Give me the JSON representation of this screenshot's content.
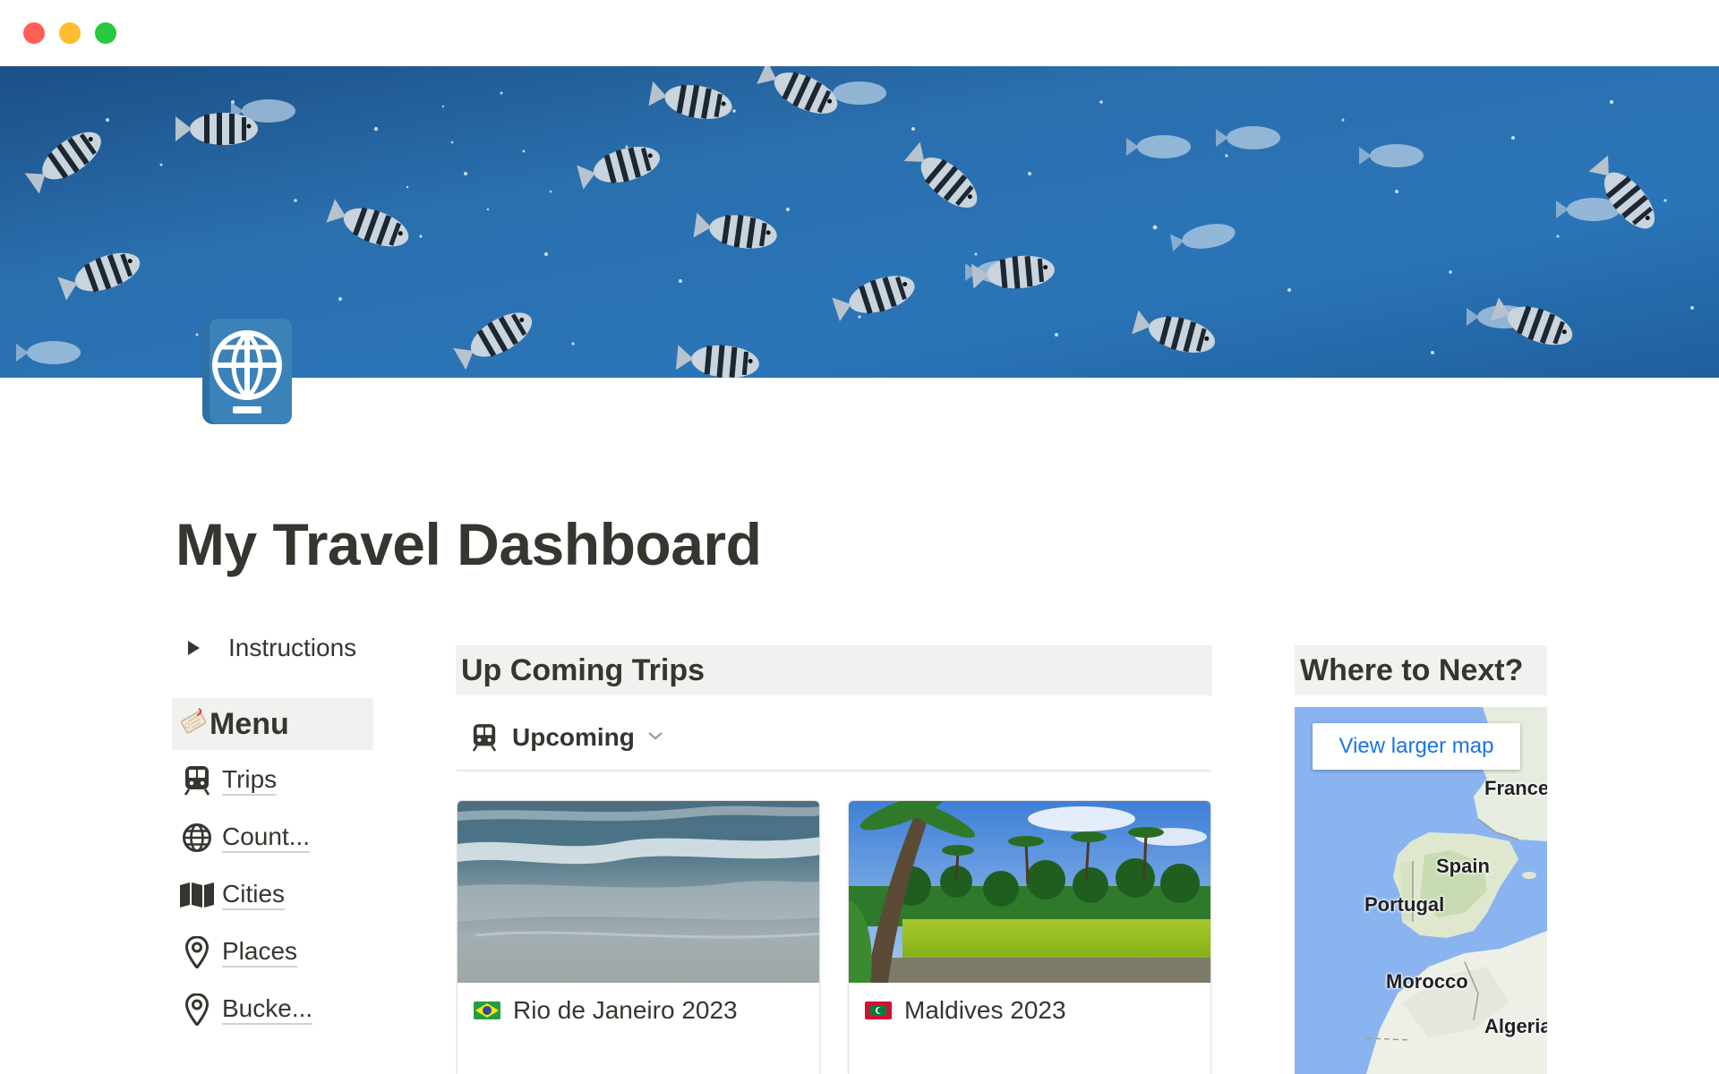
{
  "page": {
    "title": "My Travel Dashboard",
    "cover_description": "",
    "icon": "passport-icon"
  },
  "left_column": {
    "toggle_label": "Instructions",
    "menu_heading": "Menu",
    "menu_items": [
      {
        "label": "Trips",
        "icon": "train-icon"
      },
      {
        "label": "Count...",
        "icon": "globe-icon"
      },
      {
        "label": "Cities",
        "icon": "map-icon"
      },
      {
        "label": "Places",
        "icon": "pin-icon"
      },
      {
        "label": "Bucke...",
        "icon": "pin-icon"
      }
    ]
  },
  "center_column": {
    "heading": "Up Coming Trips",
    "view": {
      "label": "Upcoming",
      "icon": "train-icon"
    },
    "cards": [
      {
        "title": "Rio de Janeiro 2023",
        "flag": "brazil-flag-icon"
      },
      {
        "title": "Maldives 2023",
        "flag": "maldives-flag-icon"
      }
    ]
  },
  "right_column": {
    "heading": "Where to Next?",
    "map_button": "View larger map",
    "map_labels": [
      "France",
      "Spain",
      "Portugal",
      "Morocco",
      "Algeria"
    ]
  },
  "colors": {
    "text": "#37352f",
    "heading_bg": "#f1f1ef",
    "link_blue": "#1a73e8",
    "ocean_blue": "#1d5d96"
  }
}
